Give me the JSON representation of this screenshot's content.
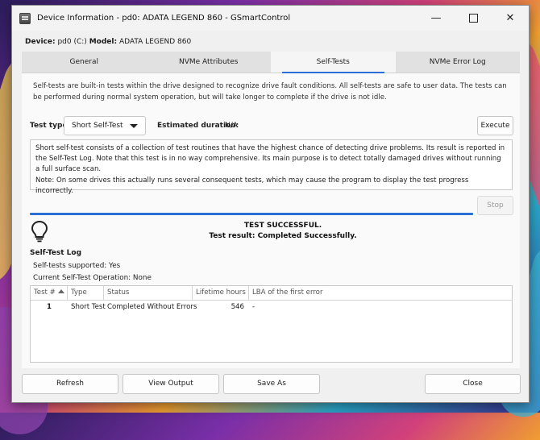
{
  "window": {
    "title": "Device Information - pd0: ADATA LEGEND 860 - GSmartControl",
    "controls": {
      "minimize": "—",
      "close": "✕"
    }
  },
  "device": {
    "device_label": "Device:",
    "device_value": "pd0 (C:)",
    "model_label": "Model:",
    "model_value": "ADATA LEGEND 860"
  },
  "tabs": [
    "General",
    "NVMe Attributes",
    "Self-Tests",
    "NVMe Error Log"
  ],
  "selftest": {
    "intro": "Self-tests are built-in tests within the drive designed to recognize drive fault conditions. All self-tests are safe to user data. The tests can be performed during normal system operation, but will take longer to complete if the drive is not idle.",
    "test_type_label": "Test type:",
    "test_type_value": "Short Self-Test",
    "duration_label": "Estimated duration:",
    "duration_value": "N/A",
    "execute_label": "Execute",
    "description": "Short self-test consists of a collection of test routines that have the highest chance of detecting drive problems. Its result is reported in the Self-Test Log. Note that this test is in no way comprehensive. Its main purpose is to detect totally damaged drives without running a full surface scan.\nNote: On some drives this actually runs several consequent tests, which may cause the program to display the test progress incorrectly.",
    "stop_label": "Stop",
    "progress_fraction": 1.0,
    "result_title": "TEST SUCCESSFUL.",
    "result_detail": "Test result: Completed Successfully."
  },
  "log": {
    "title": "Self-Test Log",
    "supported": "Self-tests supported: Yes",
    "current": "Current Self-Test Operation: None",
    "columns": [
      "Test #",
      "Type",
      "Status",
      "Lifetime hours",
      "LBA of the first error"
    ],
    "rows": [
      {
        "num": "1",
        "type": "Short Test",
        "status": "Completed Without Errors",
        "hours": "546",
        "lba": "-"
      }
    ]
  },
  "buttons": {
    "refresh": "Refresh",
    "view_output": "View Output",
    "save_as": "Save As",
    "close": "Close"
  },
  "colors": {
    "accent": "#2a6fd6"
  },
  "icons": {
    "bulb": "lightbulb-icon",
    "sort": "sort-ascending-icon",
    "app": "app-icon"
  }
}
